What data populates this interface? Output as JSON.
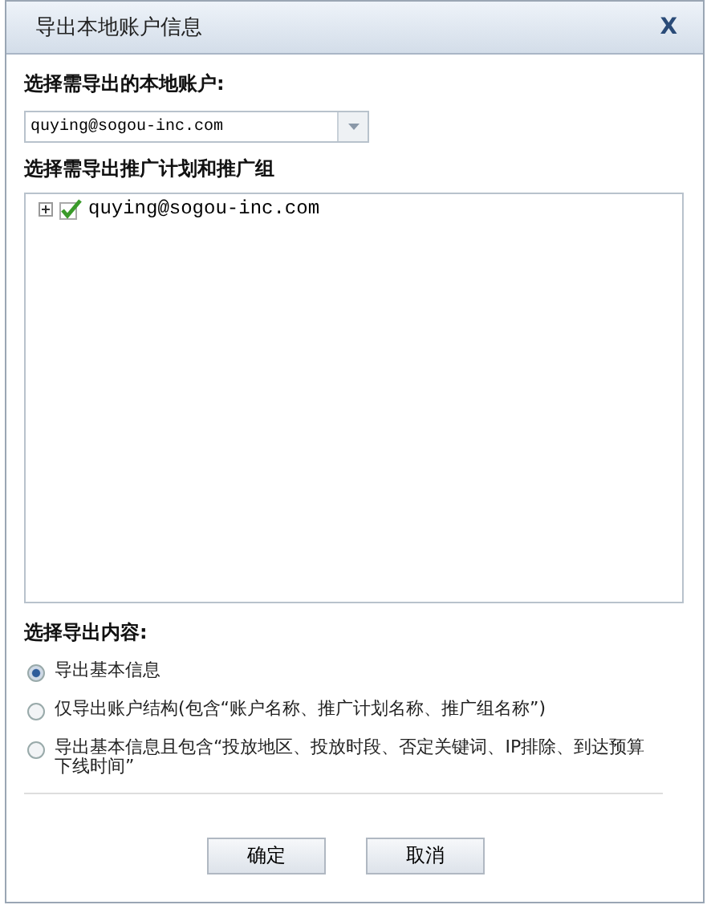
{
  "window": {
    "title": "导出本地账户信息",
    "close": "X"
  },
  "account": {
    "label": "选择需导出的本地账户:",
    "value": "quying@sogou-inc.com"
  },
  "tree": {
    "label": "选择需导出推广计划和推广组",
    "items": [
      {
        "label": "quying@sogou-inc.com",
        "expanded": false,
        "checked": true
      }
    ]
  },
  "export": {
    "label": "选择导出内容:",
    "options": [
      {
        "label": "导出基本信息",
        "selected": true
      },
      {
        "label": "仅导出账户结构(包含“账户名称、推广计划名称、推广组名称”)",
        "selected": false
      },
      {
        "label": "导出基本信息且包含“投放地区、投放时段、否定关键词、IP排除、到达预算下线时间”",
        "selected": false
      }
    ]
  },
  "buttons": [
    "确定",
    "取消"
  ]
}
